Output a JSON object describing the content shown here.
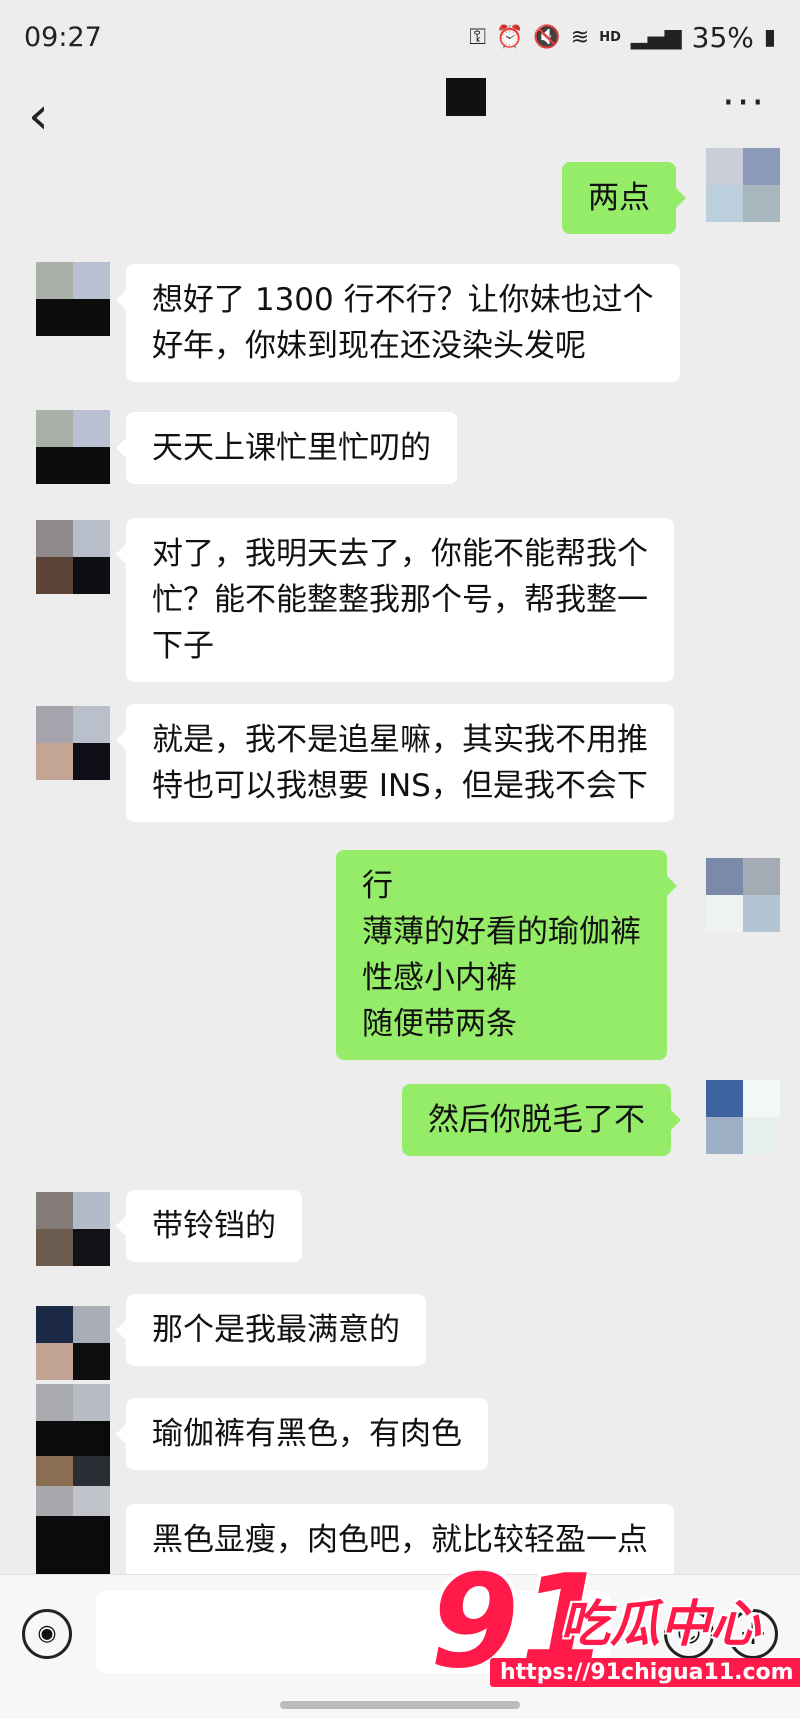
{
  "status": {
    "time": "09:27",
    "hd": "HD",
    "battery": "35%"
  },
  "nav": {
    "back_icon": "chevron-left-icon",
    "more_icon": "more-horizontal-icon"
  },
  "messages": [
    {
      "side": "right",
      "lines": [
        "两点"
      ]
    },
    {
      "side": "left",
      "lines": [
        "想好了 1300 行不行？让你妹也过个",
        "好年，你妹到现在还没染头发呢"
      ]
    },
    {
      "side": "left",
      "lines": [
        "天天上课忙里忙叨的"
      ]
    },
    {
      "side": "left",
      "lines": [
        "对了，我明天去了，你能不能帮我个",
        "忙？能不能整整我那个号，帮我整一",
        "下子"
      ]
    },
    {
      "side": "left",
      "lines": [
        "就是，我不是追星嘛，其实我不用推",
        "特也可以我想要 INS，但是我不会下"
      ]
    },
    {
      "side": "right",
      "lines": [
        "行",
        "薄薄的好看的瑜伽裤",
        "性感小内裤",
        "随便带两条"
      ]
    },
    {
      "side": "right",
      "lines": [
        "然后你脱毛了不"
      ]
    },
    {
      "side": "left",
      "lines": [
        "带铃铛的"
      ]
    },
    {
      "side": "left",
      "lines": [
        "那个是我最满意的"
      ]
    },
    {
      "side": "left",
      "lines": [
        "瑜伽裤有黑色，有肉色"
      ]
    },
    {
      "side": "left",
      "lines": [
        "黑色显瘦，肉色吧，就比较轻盈一点"
      ]
    }
  ],
  "input": {
    "voice_icon": "voice-icon",
    "emoji_icon": "emoji-icon",
    "plus_icon": "plus-icon"
  },
  "watermark": {
    "number": "91",
    "text": "吃瓜中心",
    "url": "https://91chigua11.com"
  },
  "colors": {
    "background": "#ededed",
    "bubble_self": "#95ec69",
    "bubble_other": "#ffffff"
  }
}
